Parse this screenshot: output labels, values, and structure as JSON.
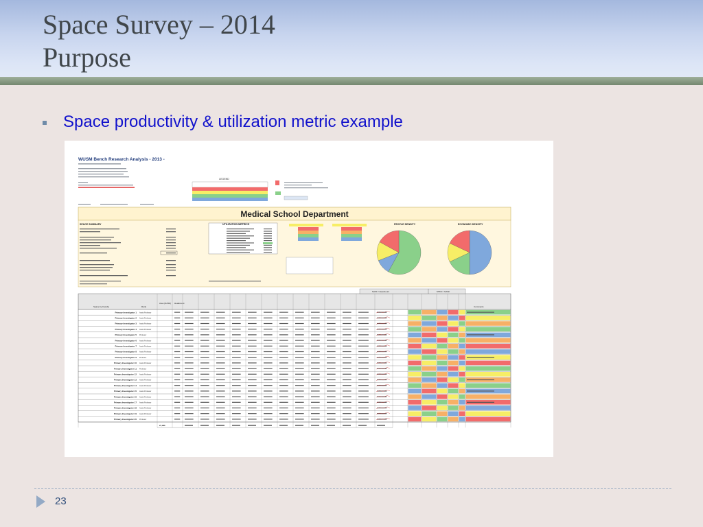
{
  "slide": {
    "title_line1": "Space Survey – 2014",
    "title_line2": "Purpose",
    "bullet": "Space productivity & utilization metric example",
    "page_number": "23"
  },
  "sheet": {
    "title": "WUSM Bench Research Analysis - 2013 -",
    "department_banner": "Medical School Department",
    "section_space_summary": "SPACE SUMMARY",
    "section_utilization": "UTILIZATION METRICS",
    "section_people_density": "PEOPLE DENSITY",
    "section_economic_density": "ECONOMIC DENSITY",
    "legend_label": "LEGEND",
    "header_nasf": "NASF / Headcount",
    "header_mtdc": "MTDC / NASF",
    "col_faculty": "Space by Faculty",
    "col_rank": "Rank",
    "col_area": "Area (NASF)",
    "col_headcount": "Headcount",
    "col_comments": "Comments",
    "total_row_label": "27,086",
    "status_colors": {
      "red": "#F26B6B",
      "orange": "#F7B066",
      "yellow": "#F7EE66",
      "green": "#8AD08A",
      "blue": "#7FA8DC"
    },
    "investigators": [
      {
        "name": "Primary Investigator 1",
        "rank": "Assist Professor"
      },
      {
        "name": "Primary Investigator 2",
        "rank": "Assist Professor"
      },
      {
        "name": "Primary Investigator 3",
        "rank": "Assist Professor"
      },
      {
        "name": "Primary Investigator 4",
        "rank": "Assist Professor"
      },
      {
        "name": "Primary Investigator 5",
        "rank": "Professor"
      },
      {
        "name": "Primary Investigator 6",
        "rank": "Assist Professor"
      },
      {
        "name": "Primary Investigator 7",
        "rank": "Assist Professor"
      },
      {
        "name": "Primary Investigator 8",
        "rank": "Assist Professor"
      },
      {
        "name": "Primary Investigator 9",
        "rank": "Professor"
      },
      {
        "name": "Primary Investigator 10",
        "rank": "Assist Professor"
      },
      {
        "name": "Primary Investigator 11",
        "rank": "Professor"
      },
      {
        "name": "Primary Investigator 12",
        "rank": "Assist Professor"
      },
      {
        "name": "Primary Investigator 13",
        "rank": "Assist Professor"
      },
      {
        "name": "Primary Investigator 14",
        "rank": "Assist Professor"
      },
      {
        "name": "Primary Investigator 15",
        "rank": "Assist Professor"
      },
      {
        "name": "Primary Investigator 16",
        "rank": "Assist Professor"
      },
      {
        "name": "Primary Investigator 17",
        "rank": "Assist Professor"
      },
      {
        "name": "Primary Investigator 18",
        "rank": "Assist Professor"
      },
      {
        "name": "Primary Investigator 19",
        "rank": "Assist Professor"
      },
      {
        "name": "Primary Investigator 20",
        "rank": "Professor"
      }
    ],
    "pie_people_density": [
      0.58,
      0.11,
      0.14,
      0.17
    ],
    "pie_economic_density": [
      0.5,
      0.18,
      0.14,
      0.18
    ]
  }
}
